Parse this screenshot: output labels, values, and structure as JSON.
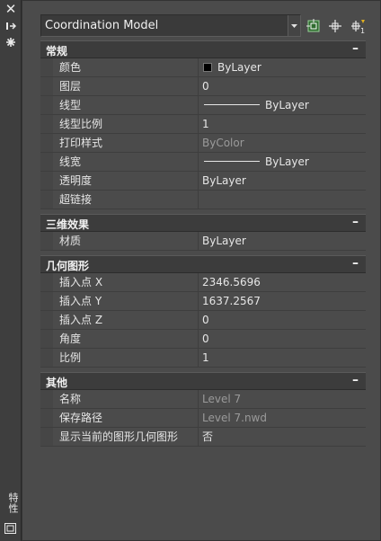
{
  "titlebar": {
    "vertical_label": "特性",
    "icons": [
      "close-icon",
      "auto-hide-icon",
      "properties-icon",
      "dock-icon"
    ]
  },
  "selector": {
    "value": "Coordination Model",
    "tools": [
      "quick-select-icon",
      "select-objects-icon",
      "toggle-pickadd-icon"
    ]
  },
  "sections": {
    "general": {
      "title": "常规",
      "collapse": "–",
      "rows": [
        {
          "name": "颜色",
          "value": "ByLayer"
        },
        {
          "name": "图层",
          "value": "0"
        },
        {
          "name": "线型",
          "value": "ByLayer"
        },
        {
          "name": "线型比例",
          "value": "1"
        },
        {
          "name": "打印样式",
          "value": "ByColor"
        },
        {
          "name": "线宽",
          "value": "ByLayer"
        },
        {
          "name": "透明度",
          "value": "ByLayer"
        },
        {
          "name": "超链接",
          "value": ""
        }
      ]
    },
    "effects3d": {
      "title": "三维效果",
      "collapse": "–",
      "rows": [
        {
          "name": "材质",
          "value": "ByLayer"
        }
      ]
    },
    "geometry": {
      "title": "几何图形",
      "collapse": "–",
      "rows": [
        {
          "name": "插入点 X",
          "value": "2346.5696"
        },
        {
          "name": "插入点 Y",
          "value": "1637.2567"
        },
        {
          "name": "插入点 Z",
          "value": "0"
        },
        {
          "name": "角度",
          "value": "0"
        },
        {
          "name": "比例",
          "value": "1"
        }
      ]
    },
    "misc": {
      "title": "其他",
      "collapse": "–",
      "rows": [
        {
          "name": "名称",
          "value": "Level 7"
        },
        {
          "name": "保存路径",
          "value": "Level 7.nwd"
        },
        {
          "name": "显示当前的图形几何图形",
          "value": "否"
        }
      ]
    }
  },
  "colors": {
    "background": "#4b4b4b",
    "section_header": "#3c3c3c",
    "text": "#e6e6e6",
    "disabled_text": "#9a9a9a"
  }
}
